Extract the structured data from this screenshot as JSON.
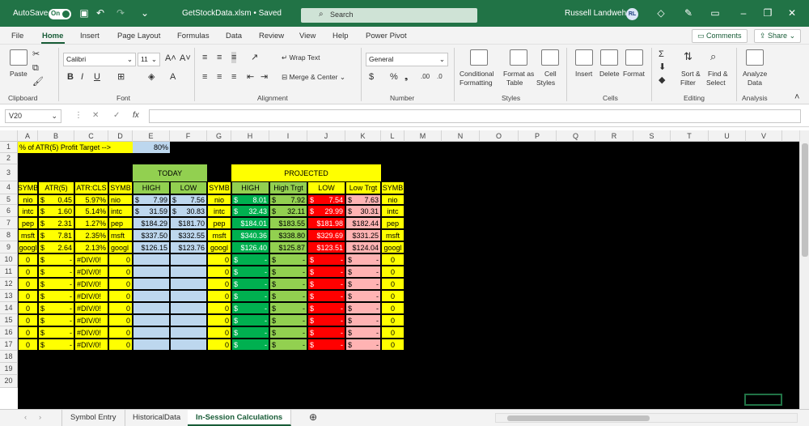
{
  "titlebar": {
    "autosave_label": "AutoSave",
    "autosave_state": "On",
    "file_title": "GetStockData.xlsm • Saved",
    "search_placeholder": "Search",
    "user_name": "Russell Landwehr",
    "user_initials": "RL"
  },
  "menu": [
    "File",
    "Home",
    "Insert",
    "Page Layout",
    "Formulas",
    "Data",
    "Review",
    "View",
    "Help",
    "Power Pivot"
  ],
  "menu_right": {
    "comments": "Comments",
    "share": "Share"
  },
  "ribbon": {
    "clipboard": {
      "paste": "Paste",
      "label": "Clipboard"
    },
    "font": {
      "name": "Calibri",
      "size": "11",
      "label": "Font"
    },
    "alignment": {
      "wrap": "Wrap Text",
      "merge": "Merge & Center",
      "label": "Alignment"
    },
    "number": {
      "format": "General",
      "label": "Number"
    },
    "styles": {
      "cond1": "Conditional",
      "cond2": "Formatting",
      "fmt1": "Format as",
      "fmt2": "Table",
      "cell1": "Cell",
      "cell2": "Styles",
      "label": "Styles"
    },
    "cells": {
      "insert": "Insert",
      "delete": "Delete",
      "format": "Format",
      "label": "Cells"
    },
    "editing": {
      "sort1": "Sort &",
      "sort2": "Filter",
      "find1": "Find &",
      "find2": "Select",
      "label": "Editing"
    },
    "analysis": {
      "a1": "Analyze",
      "a2": "Data",
      "label": "Analysis"
    }
  },
  "formula_bar": {
    "name_box": "V20",
    "formula": ""
  },
  "columns": [
    "A",
    "B",
    "C",
    "D",
    "E",
    "F",
    "G",
    "H",
    "I",
    "J",
    "K",
    "L",
    "M",
    "N",
    "O",
    "P",
    "Q",
    "R",
    "S",
    "T",
    "U",
    "V"
  ],
  "rows": [
    "1",
    "2",
    "3",
    "4",
    "5",
    "6",
    "7",
    "8",
    "9",
    "10",
    "11",
    "12",
    "13",
    "14",
    "15",
    "16",
    "17",
    "18",
    "19",
    "20"
  ],
  "sheet": {
    "row1": {
      "label": "% of ATR(5) Profit Target -->",
      "value": "80%"
    },
    "today_header": "TODAY",
    "projected_header": "PROJECTED",
    "headers": [
      "SYMB",
      "ATR(5)",
      "ATR:CLS",
      "SYMB",
      "HIGH",
      "LOW",
      "SYMB",
      "HIGH",
      "High Trgt",
      "LOW",
      "Low Trgt",
      "SYMB"
    ],
    "data_rows": [
      [
        "nio",
        "$",
        "0.45",
        "5.97%",
        "nio",
        "$",
        "7.99",
        "$",
        "7.56",
        "nio",
        "$",
        "8.01",
        "$",
        "7.92",
        "$",
        "7.54",
        "$",
        "7.63",
        "nio"
      ],
      [
        "intc",
        "$",
        "1.60",
        "5.14%",
        "intc",
        "$",
        "31.59",
        "$",
        "30.83",
        "intc",
        "$",
        "32.43",
        "$",
        "32.11",
        "$",
        "29.99",
        "$",
        "30.31",
        "intc"
      ],
      [
        "pep",
        "$",
        "2.31",
        "1.27%",
        "pep",
        "",
        "$184.29",
        "",
        "$181.70",
        "pep",
        "",
        "$184.01",
        "",
        "$183.55",
        "",
        "$181.98",
        "",
        "$182.44",
        "pep"
      ],
      [
        "msft",
        "$",
        "7.81",
        "2.35%",
        "msft",
        "",
        "$337.50",
        "",
        "$332.55",
        "msft",
        "",
        "$340.36",
        "",
        "$338.80",
        "",
        "$329.69",
        "",
        "$331.25",
        "msft"
      ],
      [
        "googl",
        "$",
        "2.64",
        "2.13%",
        "googl",
        "",
        "$126.15",
        "",
        "$123.76",
        "googl",
        "",
        "$126.40",
        "",
        "$125.87",
        "",
        "$123.51",
        "",
        "$124.04",
        "googl"
      ]
    ],
    "empty_rows": {
      "zero": "0",
      "dollar": "$",
      "dash": "-",
      "div": "#DIV/0!"
    }
  },
  "sheet_tabs": [
    "Symbol Entry",
    "HistoricalData",
    "In-Session Calculations"
  ],
  "colors": {
    "excel_green": "#217346",
    "yellow": "#ffff00",
    "light_green": "#92d050",
    "green": "#00b050",
    "red": "#ff0000",
    "pink": "#ffb3b3",
    "light_blue": "#bdd7ee"
  }
}
